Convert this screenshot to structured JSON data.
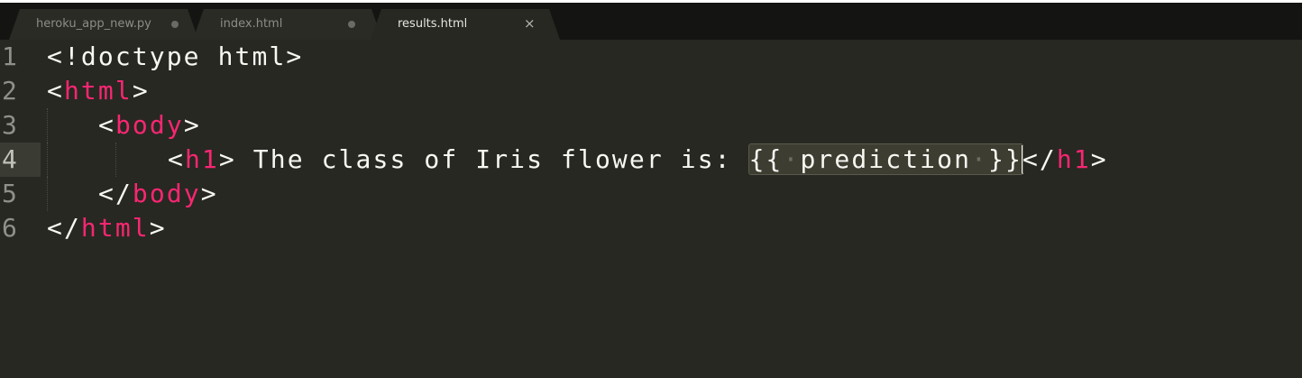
{
  "tabs": [
    {
      "label": "heroku_app_new.py",
      "modified": true,
      "active": false
    },
    {
      "label": "index.html",
      "modified": true,
      "active": false
    },
    {
      "label": "results.html",
      "modified": false,
      "active": true
    }
  ],
  "editor": {
    "current_line": 4,
    "lines": [
      {
        "number": "1",
        "parts": [
          "<!doctype html>"
        ]
      },
      {
        "number": "2",
        "parts": [
          "<",
          "html",
          ">"
        ]
      },
      {
        "number": "3",
        "parts": [
          "<",
          "body",
          ">"
        ]
      },
      {
        "number": "4",
        "parts": [
          "<",
          "h1",
          "> The class of Iris flower is: ",
          "{{",
          "·",
          "prediction",
          "·",
          "}}",
          "</",
          "h1",
          ">"
        ]
      },
      {
        "number": "5",
        "parts": [
          "</",
          "body",
          ">"
        ]
      },
      {
        "number": "6",
        "parts": [
          "</",
          "html",
          ">"
        ]
      }
    ]
  },
  "colors": {
    "background": "#272822",
    "tag": "#f92672",
    "text": "#f8f8f2",
    "line_number": "#8f908a"
  }
}
